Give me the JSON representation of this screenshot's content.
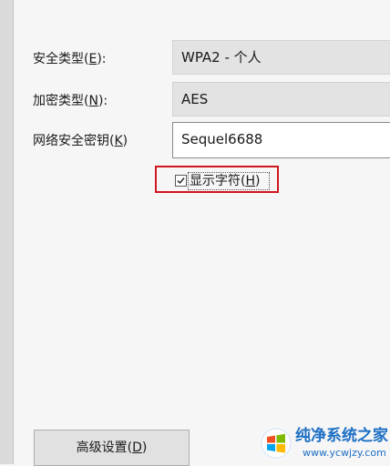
{
  "fields": {
    "security_type": {
      "label": "安全类型(",
      "accel": "E",
      "label_end": "):",
      "value": "WPA2 - 个人"
    },
    "encryption_type": {
      "label": "加密类型(",
      "accel": "N",
      "label_end": "):",
      "value": "AES"
    },
    "network_key": {
      "label": "网络安全密钥(",
      "accel": "K",
      "label_end": ")",
      "value": "Sequel6688"
    }
  },
  "show_chars": {
    "label": "显示字符(",
    "accel": "H",
    "label_end": ")",
    "checked": true,
    "highlight_color": "#d0161e"
  },
  "advanced_button": {
    "label": "高级设置(",
    "accel": "D",
    "label_end": ")"
  },
  "watermark": {
    "title": "纯净系统之家",
    "url": "www.ycwjzy.com",
    "color": "#1d6fc4"
  }
}
